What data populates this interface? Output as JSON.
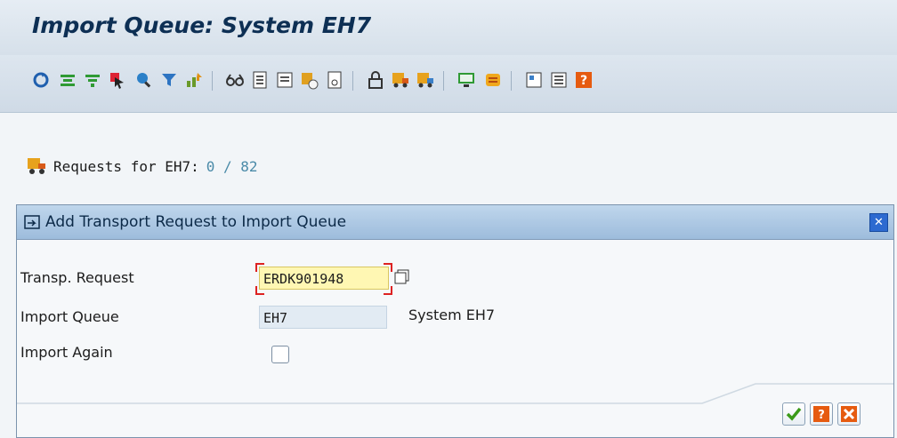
{
  "window": {
    "title": "Import Queue: System EH7"
  },
  "toolbar": {
    "icons": [
      "refresh-icon",
      "expand-all-icon",
      "collapse-icon",
      "select-icon",
      "find-icon",
      "filter-icon",
      "sort-icon",
      "glasses-icon",
      "document-icon",
      "list-icon",
      "transport-detail-icon",
      "display-icon",
      "lock-icon",
      "import-request-icon",
      "import-all-icon",
      "monitor-icon",
      "scroll-icon",
      "info-icon",
      "log-icon",
      "help-icon"
    ]
  },
  "info": {
    "label": "Requests for EH7:",
    "count": "0 / 82"
  },
  "dialog": {
    "title": "Add Transport Request to Import Queue",
    "fields": {
      "request_label": "Transp. Request",
      "request_value": "ERDK901948",
      "queue_label": "Import Queue",
      "queue_value": "EH7",
      "queue_desc": "System EH7",
      "again_label": "Import Again"
    }
  },
  "colors": {
    "accent": "#2d6ad0",
    "title": "#0d2f54"
  }
}
